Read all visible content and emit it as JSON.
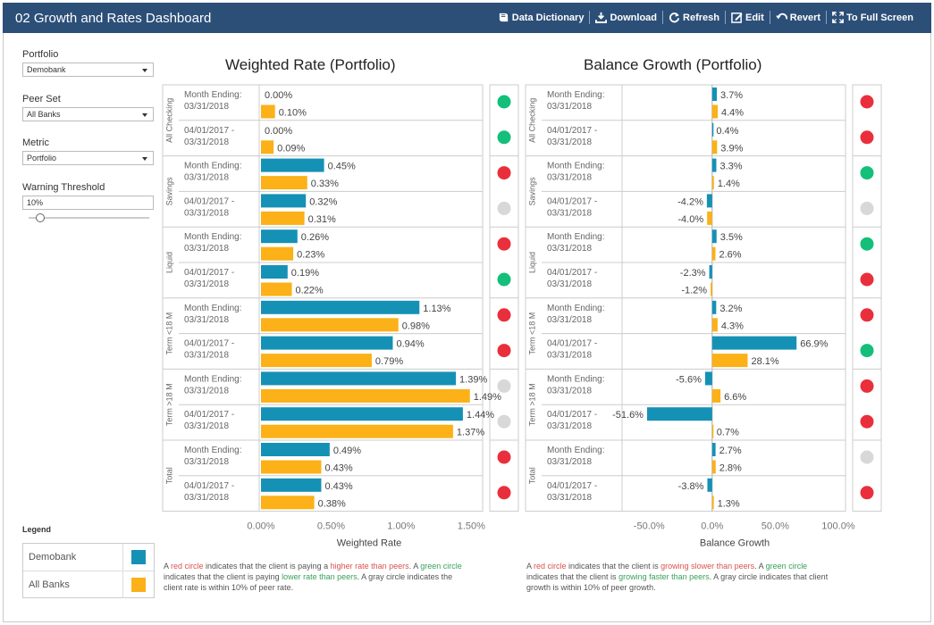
{
  "header": {
    "title": "02 Growth and Rates Dashboard",
    "actions": [
      "Data Dictionary",
      "Download",
      "Refresh",
      "Edit",
      "Revert",
      "To Full Screen"
    ]
  },
  "filters": {
    "portfolio_label": "Portfolio",
    "portfolio_value": "Demobank",
    "peer_label": "Peer Set",
    "peer_value": "All Banks",
    "metric_label": "Metric",
    "metric_value": "Portfolio",
    "threshold_label": "Warning Threshold",
    "threshold_value": "10%"
  },
  "legend": {
    "title": "Legend",
    "items": [
      {
        "label": "Demobank",
        "color": "#1591b5"
      },
      {
        "label": "All Banks",
        "color": "#fbb117"
      }
    ]
  },
  "status_colors": {
    "red": "#ea2f3c",
    "green": "#14bf7a",
    "gray": "#d8d8d8"
  },
  "notes": {
    "left": {
      "p1": "A ",
      "red": "red circle",
      "p2": " indicates that the client is paying a ",
      "red2": "higher rate than peers",
      "p3": ". A ",
      "green": "green circle",
      "p4": " indicates that the client is paying ",
      "green2": "lower rate than peers",
      "p5": ". A gray circle indicates the client rate is within 10% of peer rate."
    },
    "right": {
      "p1": "A ",
      "red": "red circle",
      "p2": " indicates that the client is ",
      "red2": "growing slower than peers",
      "p3": ". A ",
      "green": "green circle",
      "p4": " indicates that the client is ",
      "green2": "growing faster than peers",
      "p5": ". A gray circle indicates that client growth is within 10% of peer growth."
    }
  },
  "chart_data": [
    {
      "type": "bar",
      "title": "Weighted Rate (Portfolio)",
      "xlabel": "Weighted Rate",
      "xlim": [
        0,
        1.6
      ],
      "ticks": [
        "0.00%",
        "0.50%",
        "1.00%",
        "1.50%"
      ],
      "tick_values": [
        0,
        0.5,
        1.0,
        1.5
      ],
      "groups": [
        "All Checking",
        "Savings",
        "Liquid",
        "Term <18 M",
        "Term >18 M",
        "Total"
      ],
      "period_lines": [
        [
          "Month Ending:",
          "03/31/2018"
        ],
        [
          "04/01/2017 -",
          "03/31/2018"
        ]
      ],
      "series": [
        {
          "name": "Demobank",
          "values": [
            [
              0.0,
              0.0
            ],
            [
              0.45,
              0.32
            ],
            [
              0.26,
              0.19
            ],
            [
              1.13,
              0.94
            ],
            [
              1.39,
              1.44
            ],
            [
              0.49,
              0.43
            ]
          ],
          "labels": [
            [
              "0.00%",
              "0.00%"
            ],
            [
              "0.45%",
              "0.32%"
            ],
            [
              "0.26%",
              "0.19%"
            ],
            [
              "1.13%",
              "0.94%"
            ],
            [
              "1.39%",
              "1.44%"
            ],
            [
              "0.49%",
              "0.43%"
            ]
          ]
        },
        {
          "name": "All Banks",
          "values": [
            [
              0.1,
              0.09
            ],
            [
              0.33,
              0.31
            ],
            [
              0.23,
              0.22
            ],
            [
              0.98,
              0.79
            ],
            [
              1.49,
              1.37
            ],
            [
              0.43,
              0.38
            ]
          ],
          "labels": [
            [
              "0.10%",
              "0.09%"
            ],
            [
              "0.33%",
              "0.31%"
            ],
            [
              "0.23%",
              "0.22%"
            ],
            [
              "0.98%",
              "0.79%"
            ],
            [
              "1.49%",
              "1.37%"
            ],
            [
              "0.43%",
              "0.38%"
            ]
          ]
        }
      ],
      "status": [
        [
          "green",
          "green"
        ],
        [
          "red",
          "gray"
        ],
        [
          "red",
          "green"
        ],
        [
          "red",
          "red"
        ],
        [
          "gray",
          "gray"
        ],
        [
          "red",
          "red"
        ]
      ]
    },
    {
      "type": "bar",
      "title": "Balance Growth (Portfolio)",
      "xlabel": "Balance Growth",
      "xlim": [
        -70,
        105
      ],
      "ticks": [
        "-50.0%",
        "0.0%",
        "50.0%",
        "100.0%"
      ],
      "tick_values": [
        -50,
        0,
        50,
        100
      ],
      "groups": [
        "All Checking",
        "Savings",
        "Liquid",
        "Term <18 M",
        "Term >18 M",
        "Total"
      ],
      "period_lines": [
        [
          "Month Ending:",
          "03/31/2018"
        ],
        [
          "04/01/2017 -",
          "03/31/2018"
        ]
      ],
      "series": [
        {
          "name": "Demobank",
          "values": [
            [
              3.7,
              0.4
            ],
            [
              3.3,
              -4.2
            ],
            [
              3.5,
              -2.3
            ],
            [
              3.2,
              66.9
            ],
            [
              -5.6,
              -51.6
            ],
            [
              2.7,
              -3.8
            ]
          ],
          "labels": [
            [
              "3.7%",
              "0.4%"
            ],
            [
              "3.3%",
              "-4.2%"
            ],
            [
              "3.5%",
              "-2.3%"
            ],
            [
              "3.2%",
              "66.9%"
            ],
            [
              "-5.6%",
              "-51.6%"
            ],
            [
              "2.7%",
              "-3.8%"
            ]
          ]
        },
        {
          "name": "All Banks",
          "values": [
            [
              4.4,
              3.9
            ],
            [
              1.4,
              -4.0
            ],
            [
              2.6,
              -1.2
            ],
            [
              4.3,
              28.1
            ],
            [
              6.6,
              0.7
            ],
            [
              2.8,
              1.3
            ]
          ],
          "labels": [
            [
              "4.4%",
              "3.9%"
            ],
            [
              "1.4%",
              "-4.0%"
            ],
            [
              "2.6%",
              "-1.2%"
            ],
            [
              "4.3%",
              "28.1%"
            ],
            [
              "6.6%",
              "0.7%"
            ],
            [
              "2.8%",
              "1.3%"
            ]
          ]
        }
      ],
      "status": [
        [
          "red",
          "red"
        ],
        [
          "green",
          "gray"
        ],
        [
          "green",
          "red"
        ],
        [
          "red",
          "green"
        ],
        [
          "red",
          "red"
        ],
        [
          "gray",
          "red"
        ]
      ]
    }
  ]
}
